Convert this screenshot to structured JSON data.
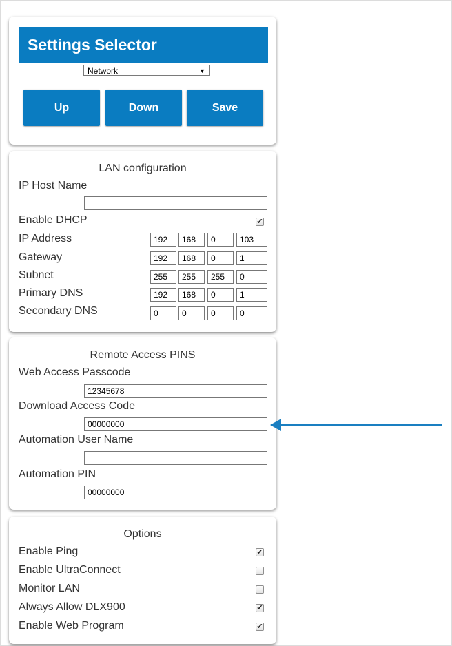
{
  "selector": {
    "title": "Settings Selector",
    "dropdown_value": "Network",
    "buttons": {
      "up": "Up",
      "down": "Down",
      "save": "Save"
    }
  },
  "lan": {
    "title": "LAN configuration",
    "host_name_label": "IP Host Name",
    "host_name_value": "",
    "dhcp_label": "Enable DHCP",
    "dhcp_checked": true,
    "ip_label": "IP Address",
    "ip": [
      "192",
      "168",
      "0",
      "103"
    ],
    "gateway_label": "Gateway",
    "gateway": [
      "192",
      "168",
      "0",
      "1"
    ],
    "subnet_label": "Subnet",
    "subnet": [
      "255",
      "255",
      "255",
      "0"
    ],
    "pdns_label": "Primary DNS",
    "pdns": [
      "192",
      "168",
      "0",
      "1"
    ],
    "sdns_label": "Secondary DNS",
    "sdns": [
      "0",
      "0",
      "0",
      "0"
    ]
  },
  "pins": {
    "title": "Remote Access PINS",
    "web_label": "Web Access Passcode",
    "web_value": "12345678",
    "download_label": "Download Access Code",
    "download_value": "00000000",
    "auto_user_label": "Automation User Name",
    "auto_user_value": "",
    "auto_pin_label": "Automation PIN",
    "auto_pin_value": "00000000"
  },
  "options": {
    "title": "Options",
    "items": [
      {
        "label": "Enable Ping",
        "checked": true
      },
      {
        "label": "Enable UltraConnect",
        "checked": false
      },
      {
        "label": "Monitor LAN",
        "checked": false
      },
      {
        "label": "Always Allow DLX900",
        "checked": true
      },
      {
        "label": "Enable Web Program",
        "checked": true
      }
    ]
  },
  "colors": {
    "accent": "#0a7cc1",
    "pointer_arrow": "#1a7fc1"
  },
  "icons": {
    "checkbox_checked": "✔",
    "dropdown_arrow": "▼"
  }
}
